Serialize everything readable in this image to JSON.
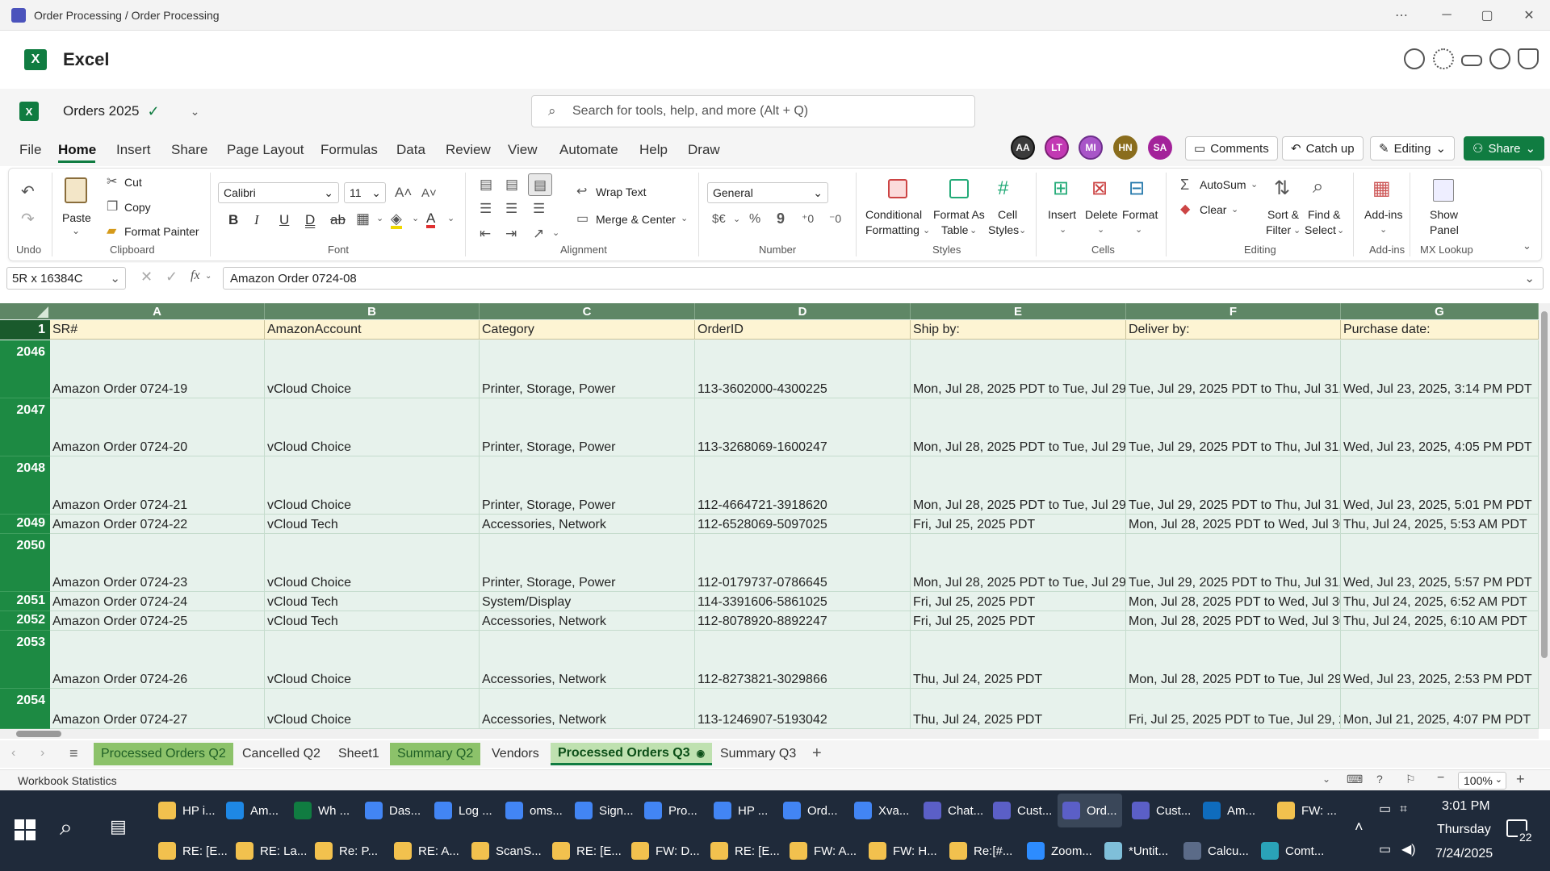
{
  "window": {
    "title": "Order Processing / Order Processing"
  },
  "app": {
    "name": "Excel"
  },
  "doc": {
    "name": "Orders 2025"
  },
  "search": {
    "placeholder": "Search for tools, help, and more (Alt + Q)"
  },
  "avatars": [
    {
      "initials": "AA",
      "color": "#3b3b3b"
    },
    {
      "initials": "LT",
      "color": "#c239b3"
    },
    {
      "initials": "MI",
      "color": "#a855c8"
    },
    {
      "initials": "HN",
      "color": "#8a6d1d"
    },
    {
      "initials": "SA",
      "color": "#a3229a"
    }
  ],
  "menu": {
    "tabs": [
      "File",
      "Home",
      "Insert",
      "Share",
      "Page Layout",
      "Formulas",
      "Data",
      "Review",
      "View",
      "Automate",
      "Help",
      "Draw"
    ],
    "comments": "Comments",
    "catchup": "Catch up",
    "editing": "Editing",
    "share": "Share"
  },
  "ribbon": {
    "clipboard": {
      "paste": "Paste",
      "cut": "Cut",
      "copy": "Copy",
      "painter": "Format Painter",
      "label": "Clipboard"
    },
    "undo": {
      "label": "Undo"
    },
    "font": {
      "name": "Calibri",
      "size": "11",
      "label": "Font"
    },
    "alignment": {
      "wrap": "Wrap Text",
      "merge": "Merge & Center",
      "label": "Alignment"
    },
    "number": {
      "format": "General",
      "label": "Number"
    },
    "styles": {
      "cond1": "Conditional",
      "cond2": "Formatting",
      "fat1": "Format As",
      "fat2": "Table",
      "cs1": "Cell",
      "cs2": "Styles",
      "label": "Styles"
    },
    "cells": {
      "insert": "Insert",
      "delete": "Delete",
      "format": "Format",
      "label": "Cells"
    },
    "editing": {
      "autosum": "AutoSum",
      "clear": "Clear",
      "sort1": "Sort &",
      "sort2": "Filter",
      "find1": "Find &",
      "find2": "Select",
      "label": "Editing"
    },
    "addins": {
      "name": "Add-ins",
      "label": "Add-ins"
    },
    "mx": {
      "show1": "Show",
      "show2": "Panel",
      "label": "MX Lookup"
    }
  },
  "formula": {
    "namebox": "5R x 16384C",
    "value": "Amazon Order 0724-08"
  },
  "grid": {
    "columns": [
      "A",
      "B",
      "C",
      "D",
      "E",
      "F",
      "G"
    ],
    "header_row": {
      "num": "1",
      "cells": [
        "SR#",
        "AmazonAccount",
        "Category",
        "OrderID",
        "Ship by:",
        "Deliver by:",
        "Purchase date:"
      ]
    },
    "rows": [
      {
        "num": "2046",
        "cells": [
          "Amazon Order 0724-19",
          "vCloud Choice",
          "Printer, Storage, Power",
          "113-3602000-4300225",
          "Mon, Jul 28, 2025 PDT to Tue, Jul 29, 2",
          "Tue, Jul 29, 2025 PDT to Thu, Jul 31, 2",
          "Wed, Jul 23, 2025, 3:14 PM PDT"
        ]
      },
      {
        "num": "2047",
        "cells": [
          "Amazon Order 0724-20",
          "vCloud Choice",
          "Printer, Storage, Power",
          "113-3268069-1600247",
          "Mon, Jul 28, 2025 PDT to Tue, Jul 29, 2",
          "Tue, Jul 29, 2025 PDT to Thu, Jul 31, 2",
          "Wed, Jul 23, 2025, 4:05 PM PDT"
        ]
      },
      {
        "num": "2048",
        "cells": [
          "Amazon Order 0724-21",
          "vCloud Choice",
          "Printer, Storage, Power",
          "112-4664721-3918620",
          "Mon, Jul 28, 2025 PDT to Tue, Jul 29, 2",
          "Tue, Jul 29, 2025 PDT to Thu, Jul 31, 2",
          "Wed, Jul 23, 2025, 5:01 PM PDT"
        ]
      },
      {
        "num": "2049",
        "cells": [
          "Amazon Order 0724-22",
          "vCloud Tech",
          "Accessories, Network",
          "112-6528069-5097025",
          "Fri, Jul 25, 2025 PDT",
          "Mon, Jul 28, 2025 PDT to Wed, Jul 30,",
          "Thu, Jul 24, 2025, 5:53 AM PDT"
        ]
      },
      {
        "num": "2050",
        "cells": [
          "Amazon Order 0724-23",
          "vCloud Choice",
          "Printer, Storage, Power",
          "112-0179737-0786645",
          "Mon, Jul 28, 2025 PDT to Tue, Jul 29, 2",
          "Tue, Jul 29, 2025 PDT to Thu, Jul 31, 2",
          "Wed, Jul 23, 2025, 5:57 PM PDT"
        ]
      },
      {
        "num": "2051",
        "cells": [
          "Amazon Order 0724-24",
          "vCloud Tech",
          "System/Display",
          "114-3391606-5861025",
          "Fri, Jul 25, 2025 PDT",
          "Mon, Jul 28, 2025 PDT to Wed, Jul 30,",
          "Thu, Jul 24, 2025, 6:52 AM PDT"
        ]
      },
      {
        "num": "2052",
        "cells": [
          "Amazon Order 0724-25",
          "vCloud Tech",
          "Accessories, Network",
          "112-8078920-8892247",
          "Fri, Jul 25, 2025 PDT",
          "Mon, Jul 28, 2025 PDT to Wed, Jul 30,",
          "Thu, Jul 24, 2025, 6:10 AM PDT"
        ]
      },
      {
        "num": "2053",
        "cells": [
          "Amazon Order 0724-26",
          "vCloud Choice",
          "Accessories, Network",
          "112-8273821-3029866",
          "Thu, Jul 24, 2025 PDT",
          "Mon, Jul 28, 2025 PDT to Tue, Jul 29, 2",
          "Wed, Jul 23, 2025, 2:53 PM PDT"
        ]
      },
      {
        "num": "2054",
        "cells": [
          "Amazon Order 0724-27",
          "vCloud Choice",
          "Accessories, Network",
          "113-1246907-5193042",
          "Thu, Jul 24, 2025 PDT",
          "Fri, Jul 25, 2025 PDT to Tue, Jul 29, 20",
          "Mon, Jul 21, 2025, 4:07 PM PDT"
        ]
      }
    ]
  },
  "sheets": [
    {
      "name": "Processed Orders Q2",
      "style": "g"
    },
    {
      "name": "Cancelled Q2",
      "style": ""
    },
    {
      "name": "Sheet1",
      "style": ""
    },
    {
      "name": "Summary Q2",
      "style": "g"
    },
    {
      "name": "Vendors",
      "style": ""
    },
    {
      "name": "Processed Orders Q3",
      "style": "active"
    },
    {
      "name": "Summary Q3",
      "style": ""
    }
  ],
  "status": {
    "left": "Workbook Statistics",
    "zoom": "100%"
  },
  "taskbar": {
    "row1": [
      {
        "label": "HP i...",
        "color": "#f2c14e"
      },
      {
        "label": "Am...",
        "color": "#1e88e5"
      },
      {
        "label": "Wh ...",
        "color": "#107c41"
      },
      {
        "label": "Das...",
        "color": "#4285f4"
      },
      {
        "label": "Log ...",
        "color": "#4285f4"
      },
      {
        "label": "oms...",
        "color": "#4285f4"
      },
      {
        "label": "Sign...",
        "color": "#4285f4"
      },
      {
        "label": "Pro...",
        "color": "#4285f4"
      },
      {
        "label": "HP ...",
        "color": "#4285f4"
      },
      {
        "label": "Ord...",
        "color": "#4285f4"
      },
      {
        "label": "Xva...",
        "color": "#4285f4"
      },
      {
        "label": "Chat...",
        "color": "#5b5fc7"
      },
      {
        "label": "Cust...",
        "color": "#5b5fc7"
      },
      {
        "label": "Ord...",
        "color": "#5b5fc7"
      },
      {
        "label": "Cust...",
        "color": "#5b5fc7"
      },
      {
        "label": "Am...",
        "color": "#0f6cbd"
      },
      {
        "label": "FW: ...",
        "color": "#f2c14e"
      }
    ],
    "row2": [
      {
        "label": "RE: [E...",
        "color": "#f2c14e"
      },
      {
        "label": "RE: La...",
        "color": "#f2c14e"
      },
      {
        "label": "Re: P...",
        "color": "#f2c14e"
      },
      {
        "label": "RE: A...",
        "color": "#f2c14e"
      },
      {
        "label": "ScanS...",
        "color": "#f2c14e"
      },
      {
        "label": "RE: [E...",
        "color": "#f2c14e"
      },
      {
        "label": "FW: D...",
        "color": "#f2c14e"
      },
      {
        "label": "RE: [E...",
        "color": "#f2c14e"
      },
      {
        "label": "FW: A...",
        "color": "#f2c14e"
      },
      {
        "label": "FW: H...",
        "color": "#f2c14e"
      },
      {
        "label": "Re:[#...",
        "color": "#f2c14e"
      },
      {
        "label": "Zoom...",
        "color": "#2d8cff"
      },
      {
        "label": "*Untit...",
        "color": "#7fbfd9"
      },
      {
        "label": "Calcu...",
        "color": "#5b6b88"
      },
      {
        "label": "Comt...",
        "color": "#2aa3b8"
      }
    ],
    "time": "3:01 PM",
    "day": "Thursday",
    "date": "7/24/2025",
    "notif": "22"
  }
}
